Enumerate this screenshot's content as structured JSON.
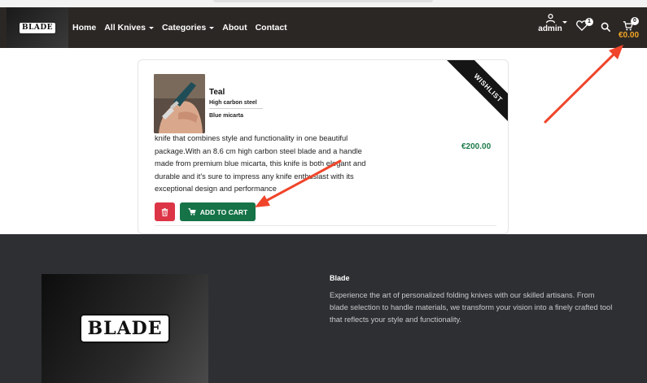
{
  "colors": {
    "navbar_bg": "#2b2725",
    "footer_bg": "#2d2f33",
    "price_green": "#1e7b4a",
    "cart_total_orange": "#f5a623",
    "add_to_cart_green": "#157347",
    "delete_red": "#dc3545",
    "annotation_arrow": "#f0452a"
  },
  "navbar": {
    "logo_text": "BLADE",
    "links": [
      {
        "label": "Home",
        "dropdown": false
      },
      {
        "label": "All Knives",
        "dropdown": true
      },
      {
        "label": "Categories",
        "dropdown": true
      },
      {
        "label": "About",
        "dropdown": false
      },
      {
        "label": "Contact",
        "dropdown": false
      }
    ],
    "account_label": "admin",
    "account_icon": "user-icon",
    "wishlist_icon": "heart-icon",
    "wishlist_count": "1",
    "search_icon": "search-icon",
    "cart_icon": "cart-icon",
    "cart_count": "0",
    "cart_total": "€0.00"
  },
  "product": {
    "name": "Teal",
    "attribute_1": "High carbon steel",
    "attribute_2": "Blue micarta",
    "description": "knife that combines style and functionality in one beautiful package.With an 8.6 cm high carbon steel blade and a handle made from premium blue micarta, this knife is both elegant and durable and it's sure to impress any knife enthusiast with its exceptional design and performance",
    "price": "€200.00",
    "ribbon_label": "WISHLIST",
    "delete_icon": "trash-icon",
    "add_to_cart_label": "ADD TO CART"
  },
  "footer": {
    "logo_text": "BLADE",
    "title": "Blade",
    "text": "Experience the art of personalized folding knives with our skilled artisans. From blade selection to handle materials, we transform your vision into a finely crafted tool that reflects your style and functionality."
  }
}
